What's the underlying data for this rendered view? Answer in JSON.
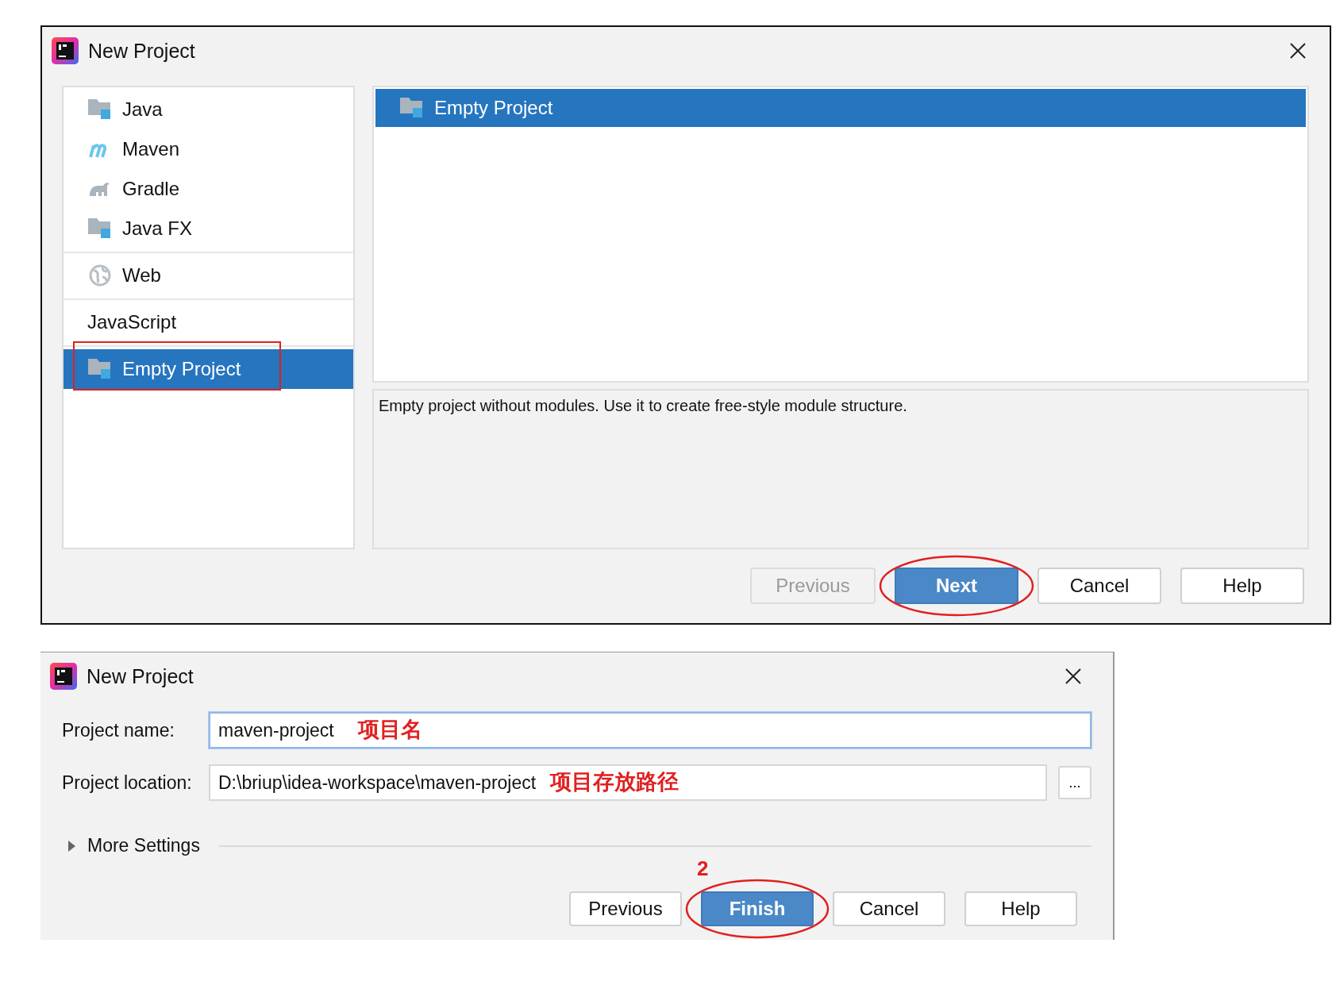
{
  "new_project_dialog": {
    "title": "New Project",
    "project_types": [
      [
        {
          "label": "Java",
          "kind": "folder",
          "selected": false,
          "annotated": false
        },
        {
          "label": "Maven",
          "kind": "maven",
          "selected": false,
          "annotated": false
        },
        {
          "label": "Gradle",
          "kind": "gradle",
          "selected": false,
          "annotated": false
        },
        {
          "label": "Java FX",
          "kind": "folder",
          "selected": false,
          "annotated": false
        }
      ],
      [
        {
          "label": "Web",
          "kind": "globe",
          "selected": false,
          "annotated": false
        }
      ],
      [
        {
          "label": "JavaScript",
          "kind": "plain",
          "selected": false,
          "annotated": false
        }
      ],
      [
        {
          "label": "Empty Project",
          "kind": "folder",
          "selected": true,
          "annotated": true
        }
      ]
    ],
    "templates": [
      {
        "label": "Empty Project",
        "selected": true
      }
    ],
    "description": "Empty project without modules. Use it to create free-style module structure.",
    "buttons": [
      {
        "label": "Previous",
        "kind": "default",
        "disabled": true,
        "annotated": false
      },
      {
        "label": "Next",
        "kind": "primary",
        "disabled": false,
        "annotated": true
      },
      {
        "label": "Cancel",
        "kind": "default",
        "disabled": false,
        "annotated": false
      },
      {
        "label": "Help",
        "kind": "default",
        "disabled": false,
        "annotated": false
      }
    ]
  },
  "project_details_dialog": {
    "title": "New Project",
    "fields": [
      {
        "label": "Project name:",
        "value": "maven-project",
        "focused": true,
        "annotation": "项目名"
      },
      {
        "label": "Project location:",
        "value": "D:\\briup\\idea-workspace\\maven-project",
        "focused": false,
        "browse": "...",
        "annotation": "项目存放路径"
      }
    ],
    "more_settings": {
      "label": "More Settings",
      "expanded": false
    },
    "step_annotation": "2",
    "buttons": [
      {
        "label": "Previous",
        "kind": "default",
        "disabled": false,
        "annotated": false
      },
      {
        "label": "Finish",
        "kind": "primary",
        "disabled": false,
        "annotated": true
      },
      {
        "label": "Cancel",
        "kind": "default",
        "disabled": false,
        "annotated": false
      },
      {
        "label": "Help",
        "kind": "default",
        "disabled": false,
        "annotated": false
      }
    ]
  }
}
